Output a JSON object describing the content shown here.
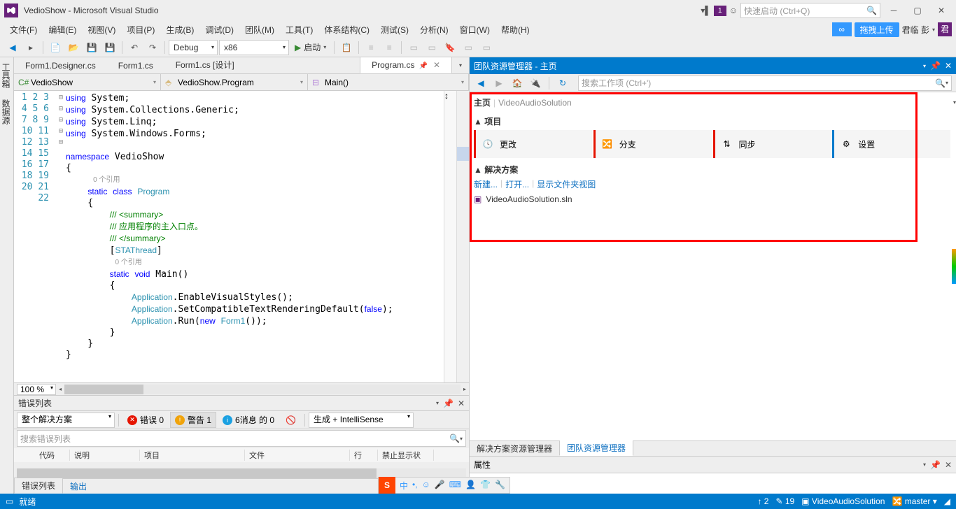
{
  "title": "VedioShow - Microsoft Visual Studio",
  "flag_count": "1",
  "quick_launch_placeholder": "快速启动 (Ctrl+Q)",
  "upload_label": "拖拽上传",
  "user_name": "君临 彭",
  "user_initial": "君",
  "menu": {
    "file": "文件(F)",
    "edit": "编辑(E)",
    "view": "视图(V)",
    "project": "项目(P)",
    "build": "生成(B)",
    "debug": "调试(D)",
    "team": "团队(M)",
    "tools": "工具(T)",
    "arch": "体系结构(C)",
    "test": "测试(S)",
    "analyze": "分析(N)",
    "window": "窗口(W)",
    "help": "帮助(H)"
  },
  "toolbar": {
    "config": "Debug",
    "platform": "x86",
    "start": "启动"
  },
  "left_tabs": {
    "toolbox": "工具箱",
    "datasource": "数据源"
  },
  "doc_tabs": {
    "t1": "Form1.Designer.cs",
    "t2": "Form1.cs",
    "t3": "Form1.cs [设计]",
    "t4": "Program.cs"
  },
  "nav": {
    "ns": "VedioShow",
    "cls": "VedioShow.Program",
    "m": "Main()"
  },
  "code": {
    "lines": [
      "1",
      "2",
      "3",
      "4",
      "5",
      "6",
      "7",
      "",
      "8",
      "9",
      "10",
      "11",
      "12",
      "13",
      "",
      "14",
      "15",
      "16",
      "17",
      "18",
      "19",
      "20",
      "21",
      "22"
    ],
    "ref0": "0 个引用",
    "summary_open": "/// <summary>",
    "summary_text": "/// 应用程序的主入口点。",
    "summary_close": "/// </summary>",
    "sta": "STAThread"
  },
  "zoom": "100 %",
  "error_panel": {
    "title": "错误列表",
    "scope": "整个解决方案",
    "errors": "错误 0",
    "warnings": "警告 1",
    "messages": "6消息 的 0",
    "build": "生成 + IntelliSense",
    "search": "搜索错误列表",
    "cols": {
      "c1": "",
      "c2": "代码",
      "c3": "说明",
      "c4": "项目",
      "c5": "文件",
      "c6": "行",
      "c7": "禁止显示状"
    },
    "tab_errors": "错误列表",
    "tab_output": "输出"
  },
  "team": {
    "title": "团队资源管理器 - 主页",
    "search": "搜索工作项 (Ctrl+')",
    "home": "主页",
    "project": "VideoAudioSolution",
    "section_project": "项目",
    "tiles": {
      "changes": "更改",
      "branches": "分支",
      "sync": "同步",
      "settings": "设置"
    },
    "section_solution": "解决方案",
    "links": {
      "new": "新建...",
      "open": "打开...",
      "show": "显示文件夹视图"
    },
    "sln": "VideoAudioSolution.sln",
    "tab_sln": "解决方案资源管理器",
    "tab_team": "团队资源管理器",
    "props": "属性"
  },
  "status": {
    "ready": "就绪",
    "up": "2",
    "pencil": "19",
    "solution": "VideoAudioSolution",
    "branch": "master"
  }
}
